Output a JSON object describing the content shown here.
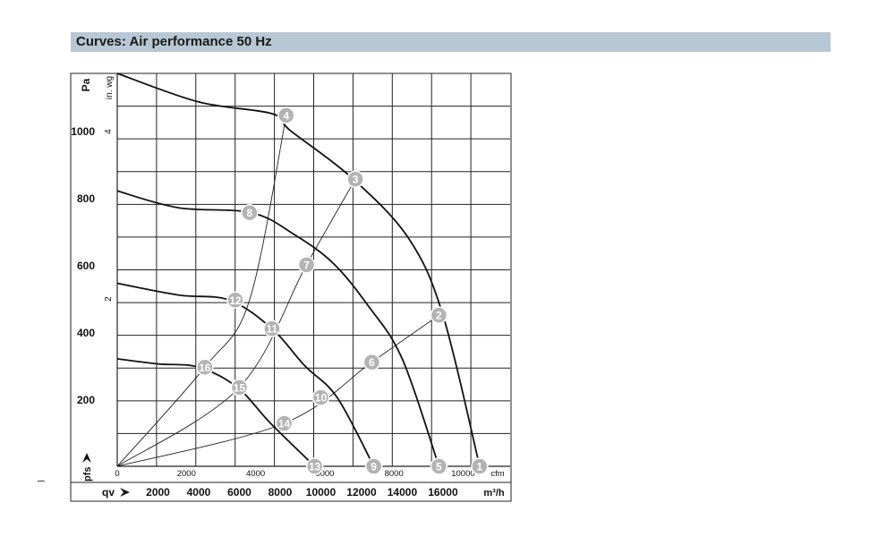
{
  "header": {
    "title": "Curves: Air performance 50 Hz"
  },
  "decor": {
    "dash": "–"
  },
  "chart_data": {
    "type": "line",
    "title": "Curves: Air performance 50 Hz",
    "y_primary": {
      "unit": "Pa",
      "ticks": [
        200,
        400,
        600,
        800,
        1000
      ],
      "range": [
        0,
        1170
      ]
    },
    "y_secondary": {
      "unit": "in. wg",
      "ticks": [
        2,
        4
      ]
    },
    "x_primary": {
      "unit": "cfm",
      "ticks": [
        0,
        2000,
        4000,
        6000,
        8000,
        10000
      ]
    },
    "x_secondary": {
      "prefix": "qv",
      "unit": "m³/h",
      "ticks": [
        2000,
        4000,
        6000,
        8000,
        10000,
        12000,
        14000,
        16000
      ],
      "range": [
        0,
        19300
      ]
    },
    "pressure_label": "pfs",
    "grid": true,
    "series": [
      {
        "x": [
          0,
          4000,
          7600,
          8500,
          11500,
          14300,
          16000,
          17800
        ],
        "y": [
          1170,
          1085,
          1050,
          1000,
          860,
          680,
          450,
          0
        ]
      },
      {
        "x": [
          0,
          3000,
          6600,
          8700,
          10600,
          12300,
          14000,
          15800
        ],
        "y": [
          820,
          770,
          755,
          690,
          605,
          480,
          320,
          0
        ]
      },
      {
        "x": [
          0,
          3000,
          5500,
          7600,
          9200,
          10800,
          12600
        ],
        "y": [
          545,
          510,
          495,
          410,
          300,
          205,
          0
        ]
      },
      {
        "x": [
          0,
          2000,
          4000,
          5900,
          7500,
          9700
        ],
        "y": [
          320,
          305,
          295,
          235,
          130,
          0
        ]
      }
    ],
    "system_curves": [
      {
        "x": [
          0,
          4300,
          6500,
          8300
        ],
        "y": [
          0,
          295,
          495,
          1045
        ]
      },
      {
        "x": [
          0,
          6000,
          9300,
          11700
        ],
        "y": [
          0,
          235,
          600,
          855
        ]
      },
      {
        "x": [
          0,
          8200,
          12500,
          15800
        ],
        "y": [
          0,
          128,
          310,
          450
        ]
      }
    ],
    "operating_points": [
      {
        "label": "1",
        "x": 17800,
        "y": 0
      },
      {
        "label": "2",
        "x": 15800,
        "y": 450
      },
      {
        "label": "3",
        "x": 11700,
        "y": 855
      },
      {
        "label": "4",
        "x": 8300,
        "y": 1045
      },
      {
        "label": "5",
        "x": 15800,
        "y": 0
      },
      {
        "label": "6",
        "x": 12500,
        "y": 310
      },
      {
        "label": "7",
        "x": 9300,
        "y": 600
      },
      {
        "label": "8",
        "x": 6500,
        "y": 755
      },
      {
        "label": "9",
        "x": 12600,
        "y": 0
      },
      {
        "label": "10",
        "x": 10000,
        "y": 205
      },
      {
        "label": "11",
        "x": 7600,
        "y": 410
      },
      {
        "label": "12",
        "x": 5800,
        "y": 495
      },
      {
        "label": "13",
        "x": 9700,
        "y": 0
      },
      {
        "label": "14",
        "x": 8200,
        "y": 128
      },
      {
        "label": "15",
        "x": 6000,
        "y": 235
      },
      {
        "label": "16",
        "x": 4300,
        "y": 295
      }
    ]
  }
}
